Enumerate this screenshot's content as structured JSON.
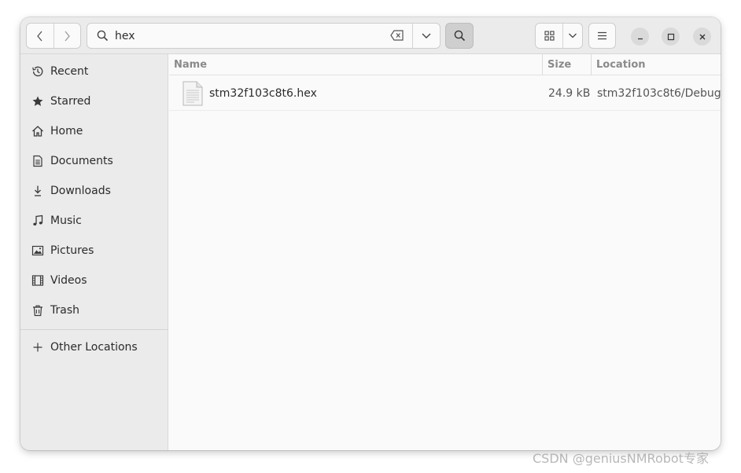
{
  "toolbar": {
    "search_value": "hex"
  },
  "sidebar": {
    "items": [
      {
        "label": "Recent",
        "icon": "clock-icon"
      },
      {
        "label": "Starred",
        "icon": "star-icon"
      },
      {
        "label": "Home",
        "icon": "home-icon"
      },
      {
        "label": "Documents",
        "icon": "document-icon"
      },
      {
        "label": "Downloads",
        "icon": "download-icon"
      },
      {
        "label": "Music",
        "icon": "music-note-icon"
      },
      {
        "label": "Pictures",
        "icon": "picture-icon"
      },
      {
        "label": "Videos",
        "icon": "film-icon"
      },
      {
        "label": "Trash",
        "icon": "trash-icon"
      }
    ],
    "other_locations": {
      "label": "Other Locations",
      "icon": "plus-icon"
    }
  },
  "files": {
    "columns": {
      "name": "Name",
      "size": "Size",
      "location": "Location"
    },
    "rows": [
      {
        "name": "stm32f103c8t6.hex",
        "size": "24.9 kB",
        "location": "stm32f103c8t6/Debug",
        "icon": "text-file-icon"
      }
    ]
  },
  "watermark": "CSDN @geniusNMRobot专家",
  "colors": {
    "accent": "#cfcfcf",
    "sidebar_bg": "#ebebeb",
    "content_bg": "#fafafa"
  }
}
